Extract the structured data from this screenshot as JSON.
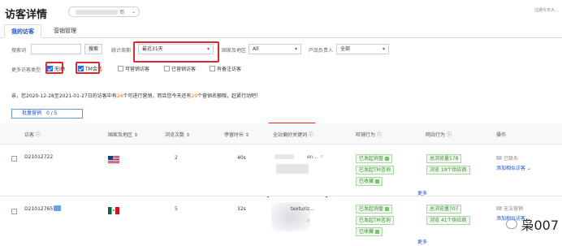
{
  "header": {
    "title": "访客详情",
    "store_suffix": "司",
    "expiry": "过期今日大…"
  },
  "tabs": [
    {
      "label": "我的访客"
    },
    {
      "label": "营销管理"
    }
  ],
  "filters": {
    "search_label": "搜索词",
    "search_button": "搜索",
    "period_label": "统计周期",
    "period_value": "最近31天",
    "region_label": "国家及地区",
    "region_value": "All",
    "owner_label": "产品负责人",
    "owner_value": "全部",
    "more_label": "更多访客类型",
    "checkboxes": [
      {
        "label": "无IM",
        "checked": true
      },
      {
        "label": "TM会话",
        "checked": true
      },
      {
        "label": "可营销访客",
        "checked": false
      },
      {
        "label": "已营销访客",
        "checked": false
      },
      {
        "label": "有备注访客",
        "checked": false
      }
    ]
  },
  "notice": {
    "pre": "亲，您2020-12-28至2021-01-27日的访客中有",
    "count1": "24",
    "mid": "个可进行营销，而且您今天还有",
    "count2": "20",
    "post": "个营销名额哦，赶紧行动吧！"
  },
  "batch_button": "批量营销　0 / 5",
  "table": {
    "columns": [
      "访客",
      "国家及地区",
      "浏览次数",
      "停留时长",
      "全站偏好关键词",
      "旺铺行为",
      "网站行为",
      "操作"
    ],
    "rows": [
      {
        "visitor": "D21012722",
        "views": "2",
        "duration": "40s",
        "keyword_fragment": "en...",
        "store_tags": [
          "已发起询盘",
          "已发起TM咨询",
          "已收藏"
        ],
        "site_tags": [
          "总浏览量178",
          "浏览 19个供应商"
        ],
        "more": "更多",
        "op_status": "已联系",
        "op_link": "添加相似访客"
      },
      {
        "visitor": "D21012765",
        "views": "5",
        "duration": "32s",
        "keyword_fragment": "texturiz...",
        "store_tags": [
          "已发起询盘",
          "已发起TM咨询",
          "已收藏"
        ],
        "site_tags": [
          "总浏览量707",
          "浏览 41个供应商"
        ],
        "more": "更多",
        "op_status": "无法营销",
        "op_link": "添加相似访客"
      }
    ]
  },
  "watermark": "枭007"
}
